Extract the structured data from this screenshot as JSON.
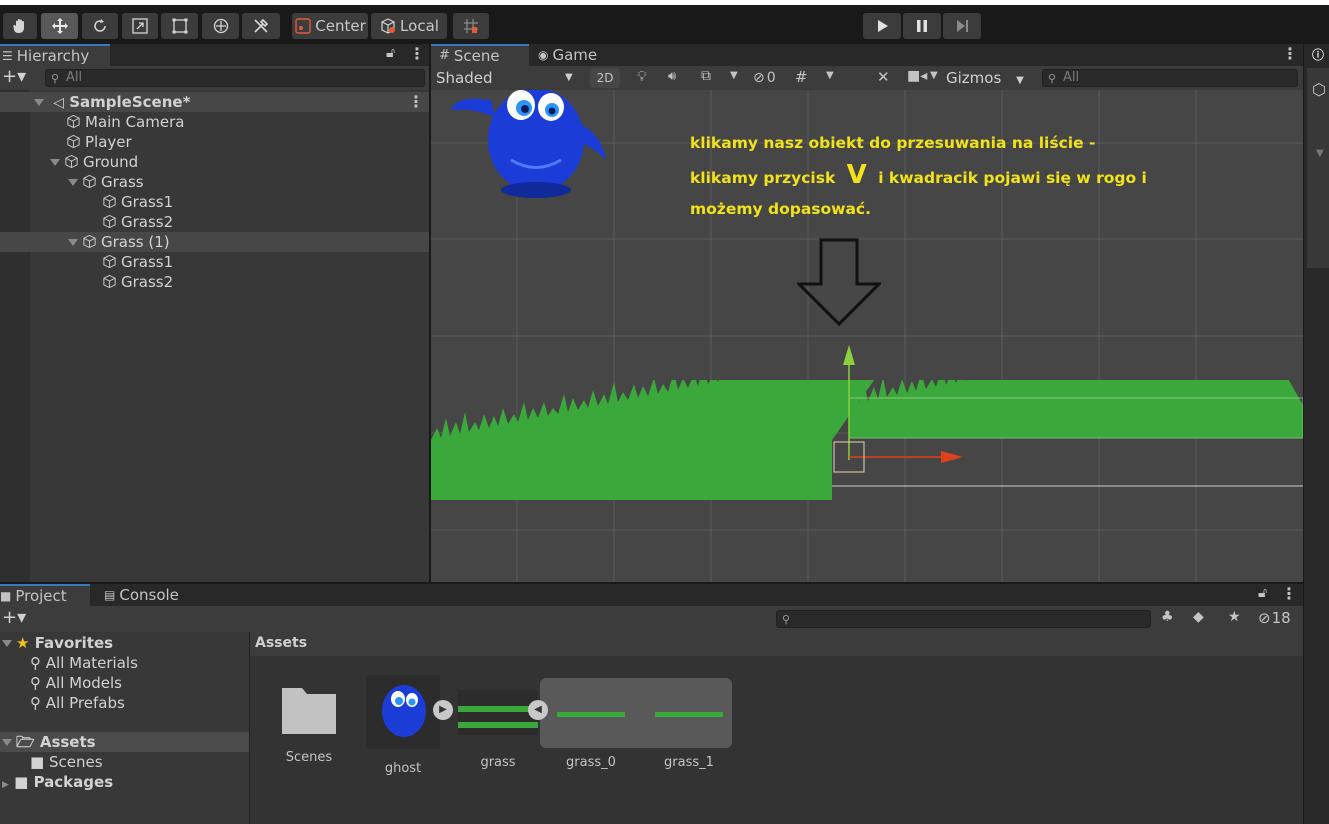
{
  "toolbar": {
    "center_label": "Center",
    "local_label": "Local",
    "tools": [
      "hand-icon",
      "move-icon",
      "rotate-icon",
      "scale-icon",
      "rect-icon",
      "transform-icon",
      "custom-tool-icon"
    ]
  },
  "hierarchy": {
    "tab_label": "Hierarchy",
    "search_placeholder": "All",
    "rows": [
      {
        "label": "SampleScene*"
      },
      {
        "label": "Main Camera"
      },
      {
        "label": "Player"
      },
      {
        "label": "Ground"
      },
      {
        "label": "Grass"
      },
      {
        "label": "Grass1"
      },
      {
        "label": "Grass2"
      },
      {
        "label": "Grass (1)"
      },
      {
        "label": "Grass1"
      },
      {
        "label": "Grass2"
      }
    ]
  },
  "scene": {
    "tabs": [
      {
        "label": "Scene"
      },
      {
        "label": "Game"
      }
    ],
    "shading_mode": "Shaded",
    "mode_2d": "2D",
    "hidden_count": "0",
    "gizmos_label": "Gizmos",
    "search_placeholder": "All",
    "annotation": {
      "line1": "klikamy nasz obiekt do przesuwania na liście -",
      "line2_a": "klikamy przycisk",
      "line2_key": "V",
      "line2_b": "i kwadracik pojawi się w rogo i",
      "line3": "możemy dopasować."
    }
  },
  "project": {
    "tabs": [
      {
        "label": "Project"
      },
      {
        "label": "Console"
      }
    ],
    "hidden_count": "18",
    "sidebar": {
      "favorites": "Favorites",
      "all_materials": "All Materials",
      "all_models": "All Models",
      "all_prefabs": "All Prefabs",
      "assets": "Assets",
      "scenes": "Scenes",
      "packages": "Packages"
    },
    "breadcrumb": "Assets",
    "assets": [
      {
        "label": "Scenes"
      },
      {
        "label": "ghost"
      },
      {
        "label": "grass"
      },
      {
        "label": "grass_0"
      },
      {
        "label": "grass_1"
      }
    ]
  },
  "colors": {
    "accent_blue": "#3a79bb",
    "annotation_yellow": "#f2e21a",
    "gizmo_green": "#8bd13b",
    "gizmo_red": "#e0401c",
    "grass_green": "#3aa83a"
  }
}
